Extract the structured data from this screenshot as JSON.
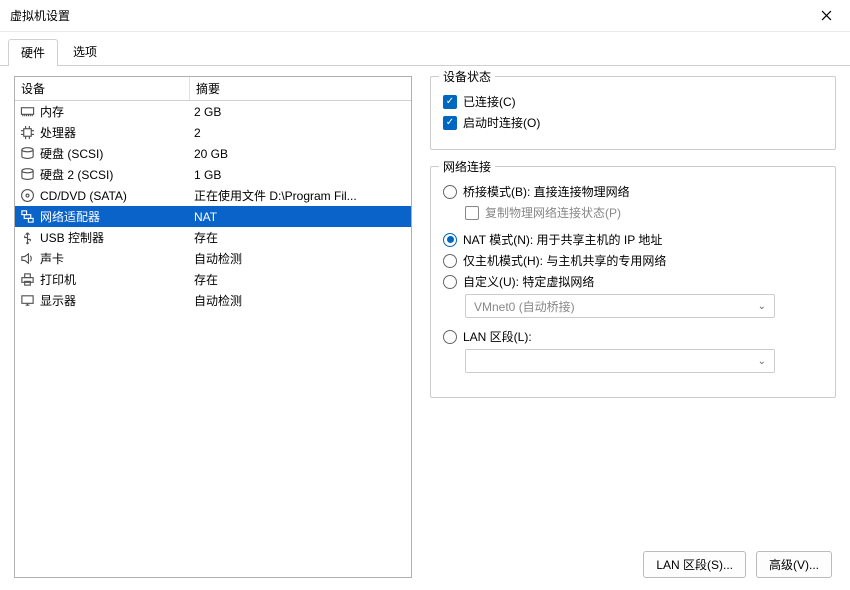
{
  "window": {
    "title": "虚拟机设置"
  },
  "tabs": {
    "hardware": "硬件",
    "options": "选项"
  },
  "table": {
    "header_device": "设备",
    "header_summary": "摘要",
    "rows": [
      {
        "icon": "memory",
        "name": "内存",
        "summary": "2 GB"
      },
      {
        "icon": "cpu",
        "name": "处理器",
        "summary": "2"
      },
      {
        "icon": "disk",
        "name": "硬盘 (SCSI)",
        "summary": "20 GB"
      },
      {
        "icon": "disk",
        "name": "硬盘 2 (SCSI)",
        "summary": "1 GB"
      },
      {
        "icon": "cd",
        "name": "CD/DVD (SATA)",
        "summary": "正在使用文件 D:\\Program Fil..."
      },
      {
        "icon": "network",
        "name": "网络适配器",
        "summary": "NAT"
      },
      {
        "icon": "usb",
        "name": "USB 控制器",
        "summary": "存在"
      },
      {
        "icon": "sound",
        "name": "声卡",
        "summary": "自动检测"
      },
      {
        "icon": "printer",
        "name": "打印机",
        "summary": "存在"
      },
      {
        "icon": "display",
        "name": "显示器",
        "summary": "自动检测"
      }
    ],
    "selected_index": 5
  },
  "status_group": {
    "title": "设备状态",
    "connected": "已连接(C)",
    "connect_at_poweron": "启动时连接(O)"
  },
  "network_group": {
    "title": "网络连接",
    "bridged": "桥接模式(B): 直接连接物理网络",
    "replicate": "复制物理网络连接状态(P)",
    "nat": "NAT 模式(N): 用于共享主机的 IP 地址",
    "host_only": "仅主机模式(H): 与主机共享的专用网络",
    "custom": "自定义(U): 特定虚拟网络",
    "custom_select": "VMnet0 (自动桥接)",
    "lan_segment": "LAN 区段(L):",
    "lan_select": ""
  },
  "buttons": {
    "lan_segments": "LAN 区段(S)...",
    "advanced": "高级(V)..."
  }
}
